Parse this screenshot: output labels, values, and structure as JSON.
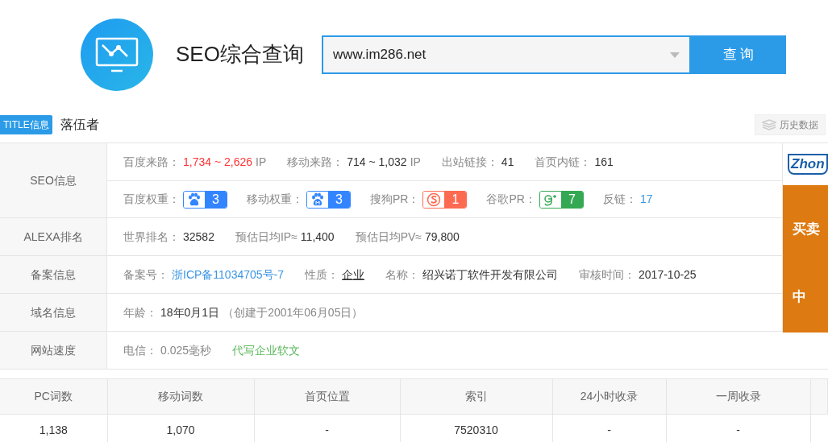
{
  "header": {
    "title": "SEO综合查询",
    "search": {
      "value": "www.im286.net"
    },
    "query_button": "查 询"
  },
  "title_bar": {
    "badge": "TITLE信息",
    "site_title": "落伍者",
    "history_button": "历史数据"
  },
  "info_table": {
    "rows": [
      {
        "label": "SEO信息",
        "lines": [
          [
            {
              "kind": "alert",
              "label": "百度来路：",
              "value": "1,734 ~ 2,626",
              "suffix": "IP"
            },
            {
              "kind": "pair",
              "label": "移动来路：",
              "value": "714 ~ 1,032",
              "suffix": "IP"
            },
            {
              "kind": "pair",
              "label": "出站链接：",
              "value": "41"
            },
            {
              "kind": "pair",
              "label": "首页内链：",
              "value": "161"
            }
          ],
          [
            {
              "kind": "baidu",
              "label": "百度权重：",
              "value": "3",
              "color": "#3385ff"
            },
            {
              "kind": "mobile",
              "label": "移动权重：",
              "value": "3",
              "color": "#3385ff"
            },
            {
              "kind": "sogou",
              "label": "搜狗PR：",
              "value": "1",
              "color": "#fd6a52"
            },
            {
              "kind": "google",
              "label": "谷歌PR：",
              "value": "7",
              "color": "#34a853"
            },
            {
              "kind": "linked",
              "label": "反链：",
              "value": "17"
            }
          ]
        ]
      },
      {
        "label": "ALEXA排名",
        "lines": [
          [
            {
              "kind": "pair",
              "label": "世界排名：",
              "value": "32582"
            },
            {
              "kind": "pair",
              "label": "预估日均IP≈",
              "value": "11,400"
            },
            {
              "kind": "pair",
              "label": "预估日均PV≈",
              "value": "79,800"
            }
          ]
        ]
      },
      {
        "label": "备案信息",
        "lines": [
          [
            {
              "kind": "linked",
              "label": "备案号：",
              "value": "浙ICP备11034705号-7"
            },
            {
              "kind": "underlined",
              "label": "性质：",
              "value": "企业"
            },
            {
              "kind": "pair",
              "label": "名称：",
              "value": "绍兴诺丁软件开发有限公司"
            },
            {
              "kind": "pair",
              "label": "审核时间：",
              "value": "2017-10-25"
            }
          ]
        ]
      },
      {
        "label": "域名信息",
        "lines": [
          [
            {
              "kind": "pair",
              "label": "年龄：",
              "value": "18年0月1日",
              "suffix": "（创建于2001年06月05日）"
            }
          ]
        ]
      },
      {
        "label": "网站速度",
        "lines": [
          [
            {
              "kind": "muted",
              "label": "电信：",
              "value": "0.025毫秒"
            },
            {
              "kind": "promo",
              "value": "代写企业软文"
            }
          ]
        ]
      }
    ]
  },
  "ad": {
    "logo": "Zhon",
    "line_1": "买卖",
    "line_2": "中"
  },
  "rank_table": {
    "columns": [
      "PC词数",
      "移动词数",
      "首页位置",
      "索引",
      "24小时收录",
      "一周收录"
    ],
    "rows": [
      [
        "1,138",
        "1,070",
        "-",
        "7520310",
        "-",
        "-"
      ]
    ]
  }
}
